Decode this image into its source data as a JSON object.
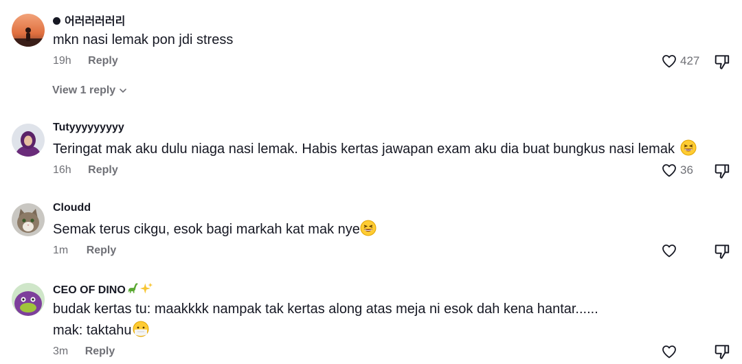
{
  "comments": [
    {
      "username": "어러러러러리",
      "lines": [
        "mkn nasi lemak pon jdi stress"
      ],
      "time": "19h",
      "reply_label": "Reply",
      "likes": "427",
      "view_replies": "View 1 reply"
    },
    {
      "username": "Tutyyyyyyyyy",
      "lines": [
        "Teringat mak aku dulu niaga nasi lemak. Habis kertas jawapan exam aku dia buat bungkus nasi lemak"
      ],
      "time": "16h",
      "reply_label": "Reply",
      "likes": "36"
    },
    {
      "username": "Cloudd",
      "lines": [
        "Semak terus cikgu, esok bagi markah kat mak nye"
      ],
      "time": "1m",
      "reply_label": "Reply",
      "likes": ""
    },
    {
      "username": "CEO OF DINO",
      "lines": [
        "budak kertas tu: maakkkk nampak tak kertas along atas meja ni esok dah kena hantar......",
        "mak: taktahu"
      ],
      "time": "3m",
      "reply_label": "Reply",
      "likes": ""
    }
  ],
  "icons": {
    "like": "heart-outline-icon",
    "dislike": "thumbs-down-outline-icon",
    "chevron": "chevron-down-icon",
    "emoji_grin": "grinning-squinting-face-emoji",
    "emoji_dino": "sauropod-emoji",
    "emoji_sparkles": "sparkles-emoji",
    "emoji_shrug": "face-with-hand-emoji"
  },
  "colors": {
    "text": "#161823",
    "secondary": "#6f7076",
    "background": "#ffffff"
  }
}
